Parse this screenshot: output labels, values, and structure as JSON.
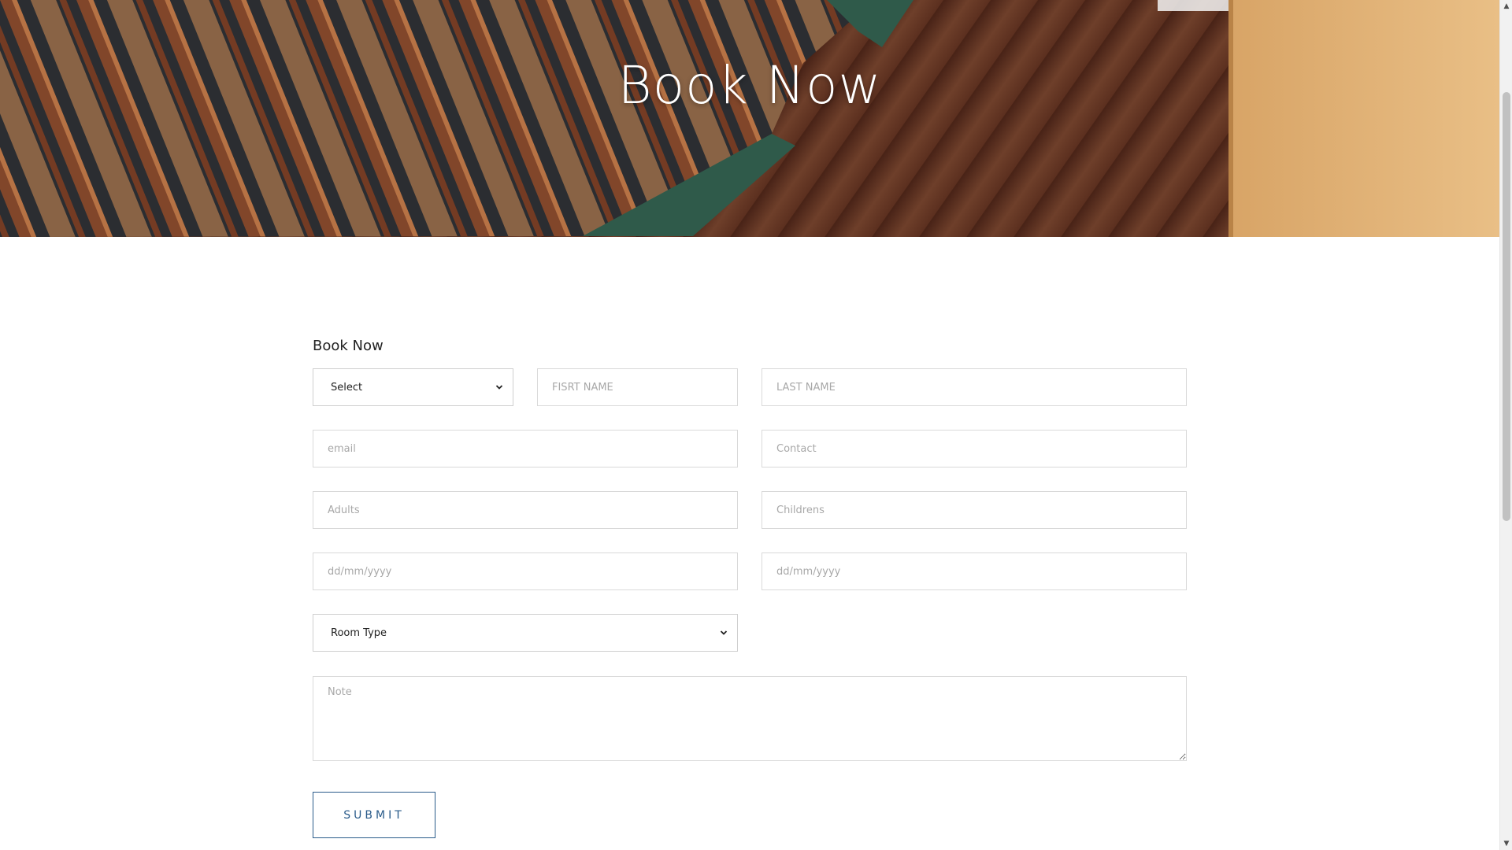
{
  "hero": {
    "title": "Book Now"
  },
  "form": {
    "title": "Book Now",
    "salutation_select": {
      "value": "Select"
    },
    "first_name": {
      "placeholder": "FISRT NAME"
    },
    "last_name": {
      "placeholder": "LAST NAME"
    },
    "email": {
      "placeholder": "email"
    },
    "contact": {
      "placeholder": "Contact"
    },
    "adults": {
      "placeholder": "Adults"
    },
    "childrens": {
      "placeholder": "Childrens"
    },
    "check_in": {
      "placeholder": "dd/mm/yyyy"
    },
    "check_out": {
      "placeholder": "dd/mm/yyyy"
    },
    "room_type_select": {
      "value": "Room Type"
    },
    "note": {
      "placeholder": "Note"
    },
    "submit_label": "SUBMIT"
  },
  "colors": {
    "accent": "#2a5b8a",
    "border": "#d9d9d9",
    "placeholder": "#a8a8a8"
  },
  "icons": {
    "select_arrow": "chevron-down-icon",
    "scroll_up": "scroll-up-arrow-icon",
    "scroll_down": "scroll-down-arrow-icon"
  }
}
